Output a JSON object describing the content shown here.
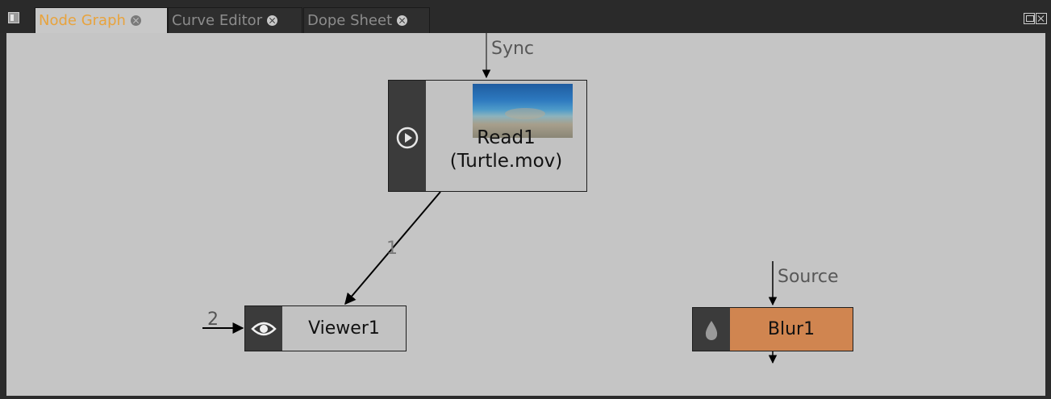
{
  "tabs": [
    {
      "label": "Node Graph",
      "active": true
    },
    {
      "label": "Curve Editor",
      "active": false
    },
    {
      "label": "Dope Sheet",
      "active": false
    }
  ],
  "colors": {
    "active_tab_text": "#e8a33d",
    "canvas_bg": "#c5c5c5",
    "blur_node": "#d08550",
    "node_side": "#3b3b3b"
  },
  "nodes": {
    "read1": {
      "label_line1": "Read1",
      "label_line2": "(Turtle.mov)",
      "icon": "play-icon"
    },
    "viewer1": {
      "label": "Viewer1",
      "icon": "eye-icon"
    },
    "blur1": {
      "label": "Blur1",
      "icon": "drop-icon"
    }
  },
  "edges": {
    "sync": "Sync",
    "source": "Source",
    "input_1": "1",
    "input_2": "2"
  }
}
